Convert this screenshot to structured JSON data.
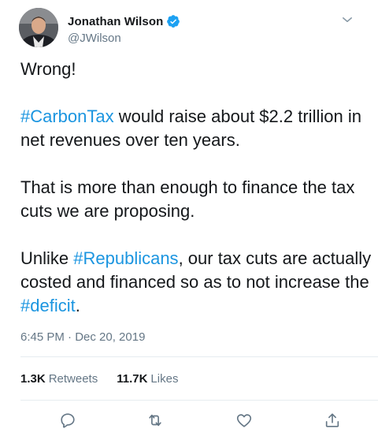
{
  "author": {
    "display_name": "Jonathan Wilson",
    "handle": "@JWilson",
    "verified": true,
    "verified_color": "#1da1f2"
  },
  "tweet": {
    "lines": [
      {
        "type": "text",
        "segments": [
          {
            "text": "Wrong!",
            "hashtag": false
          }
        ]
      },
      {
        "type": "gap"
      },
      {
        "type": "text",
        "segments": [
          {
            "text": "#CarbonTax",
            "hashtag": true
          },
          {
            "text": " would raise about $2.2 trillion in net revenues over ten years.",
            "hashtag": false
          }
        ]
      },
      {
        "type": "gap"
      },
      {
        "type": "text",
        "segments": [
          {
            "text": "That is more than enough to finance the tax cuts we are proposing.",
            "hashtag": false
          }
        ]
      },
      {
        "type": "gap"
      },
      {
        "type": "text",
        "segments": [
          {
            "text": "Unlike ",
            "hashtag": false
          },
          {
            "text": "#Republicans",
            "hashtag": true
          },
          {
            "text": ", our tax cuts are actually costed and financed so as to not increase the ",
            "hashtag": false
          },
          {
            "text": "#deficit",
            "hashtag": true
          },
          {
            "text": ".",
            "hashtag": false
          }
        ]
      }
    ],
    "timestamp": "6:45 PM · Dec 20, 2019"
  },
  "stats": {
    "retweets_count": "1.3K",
    "retweets_label": "Retweets",
    "likes_count": "11.7K",
    "likes_label": "Likes"
  },
  "actions": {
    "reply_icon": "reply-icon",
    "retweet_icon": "retweet-icon",
    "like_icon": "heart-icon",
    "share_icon": "share-icon"
  },
  "colors": {
    "hashtag": "#1b95e0",
    "secondary_text": "#657786",
    "icon": "#657786"
  }
}
